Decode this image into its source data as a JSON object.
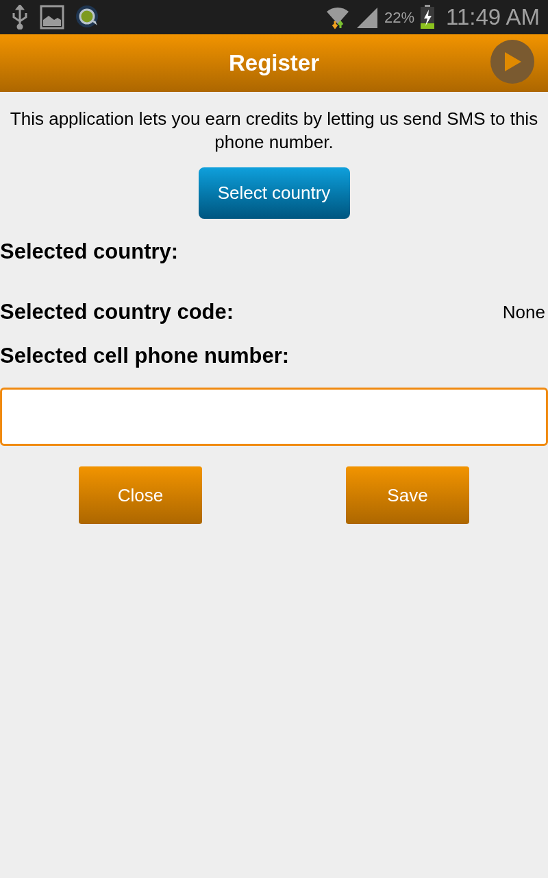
{
  "status_bar": {
    "battery": "22%",
    "time": "11:49 AM"
  },
  "header": {
    "title": "Register"
  },
  "intro": "This application lets you earn credits by letting us send SMS to this phone number.",
  "select_button": "Select country",
  "fields": [
    {
      "label": "Selected country:"
    },
    {
      "label": "Selected country code:",
      "value": "None"
    },
    {
      "label": "Selected cell phone number:"
    }
  ],
  "phone_input": {
    "focused": true
  },
  "buttons": [
    "Close",
    "Save"
  ]
}
